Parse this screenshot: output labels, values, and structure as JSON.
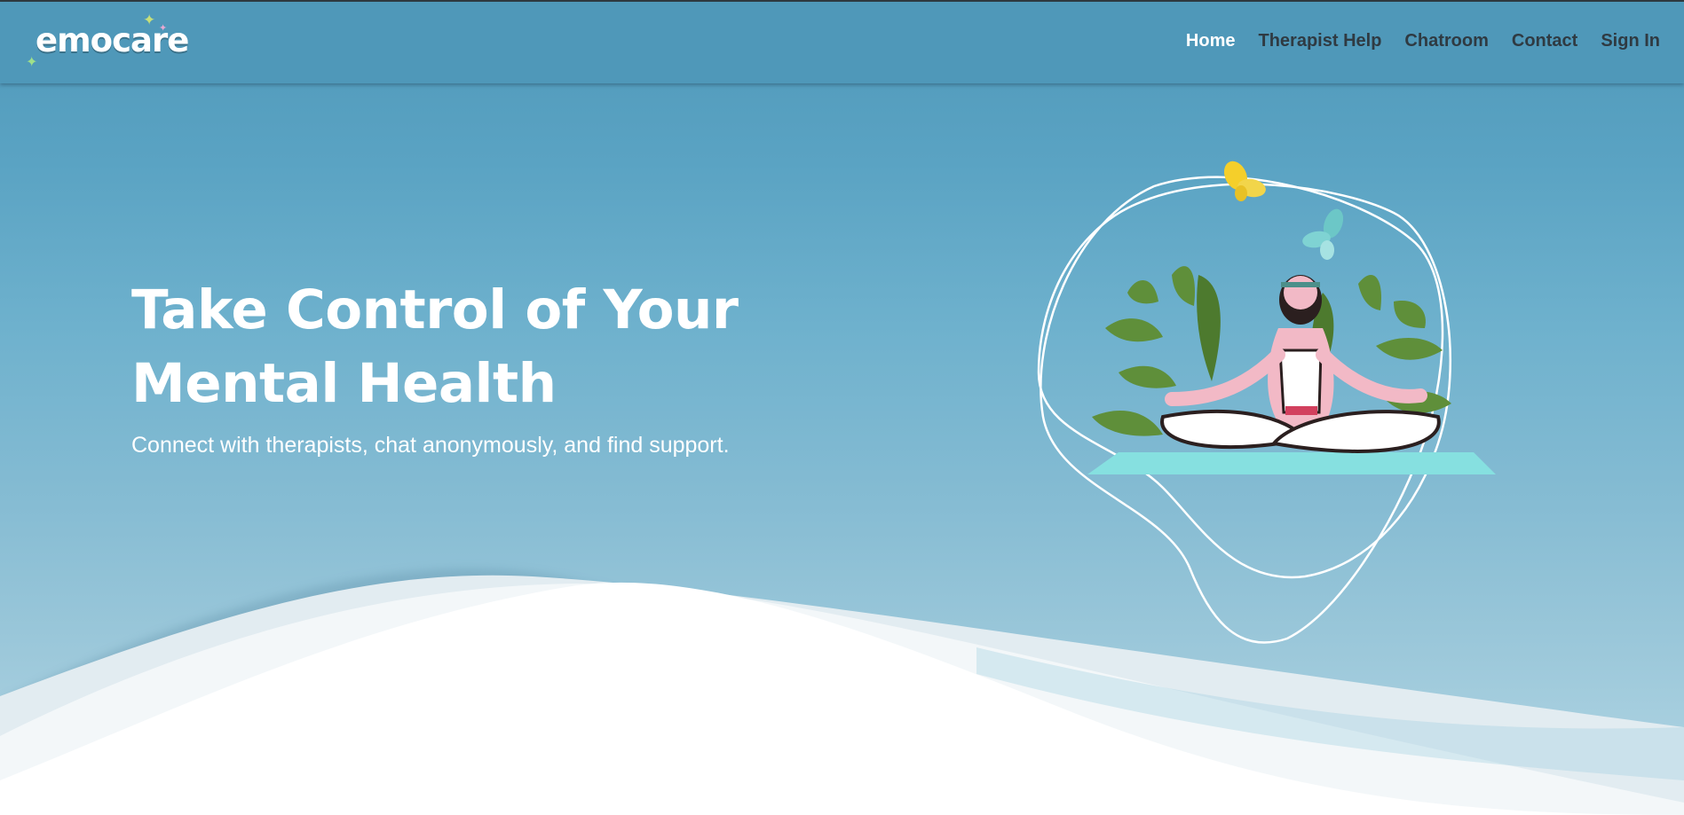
{
  "brand": {
    "logo_text": "emocare"
  },
  "nav": {
    "items": [
      {
        "label": "Home",
        "active": true
      },
      {
        "label": "Therapist Help",
        "active": false
      },
      {
        "label": "Chatroom",
        "active": false
      },
      {
        "label": "Contact",
        "active": false
      },
      {
        "label": "Sign In",
        "active": false
      }
    ]
  },
  "hero": {
    "title_line1": "Take Control of Your",
    "title_line2": "Mental Health",
    "subtitle": "Connect with therapists, chat anonymously, and find support."
  },
  "colors": {
    "header_bg": "#4f98b9",
    "text_white": "#ffffff",
    "nav_text": "#2f3a42",
    "accent_mat": "#86e0e0"
  },
  "icons": {
    "logo_sparkles": "sparkle-icon",
    "butterflies": [
      "butterfly-yellow-icon",
      "butterfly-teal-icon"
    ]
  }
}
